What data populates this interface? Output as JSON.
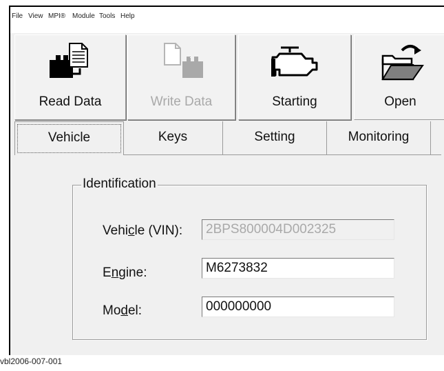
{
  "menu": [
    "File",
    "View",
    "MPI®",
    "Module",
    "Tools",
    "Help"
  ],
  "toolbar": {
    "read_data": "Read Data",
    "write_data": "Write Data",
    "starting": "Starting",
    "open": "Open"
  },
  "tabs": [
    "Vehicle",
    "Keys",
    "Setting",
    "Monitoring"
  ],
  "identification": {
    "title": "Identification",
    "vin_label_pre": "Vehi",
    "vin_label_acc": "c",
    "vin_label_post": "le (VIN):",
    "vin_value": "2BPS800004D002325",
    "engine_label_pre": "E",
    "engine_label_acc": "n",
    "engine_label_post": "gine:",
    "engine_value": "M6273832",
    "model_label_pre": "Mo",
    "model_label_acc": "d",
    "model_label_post": "el:",
    "model_value": "000000000"
  },
  "caption": "vbl2006-007-001"
}
